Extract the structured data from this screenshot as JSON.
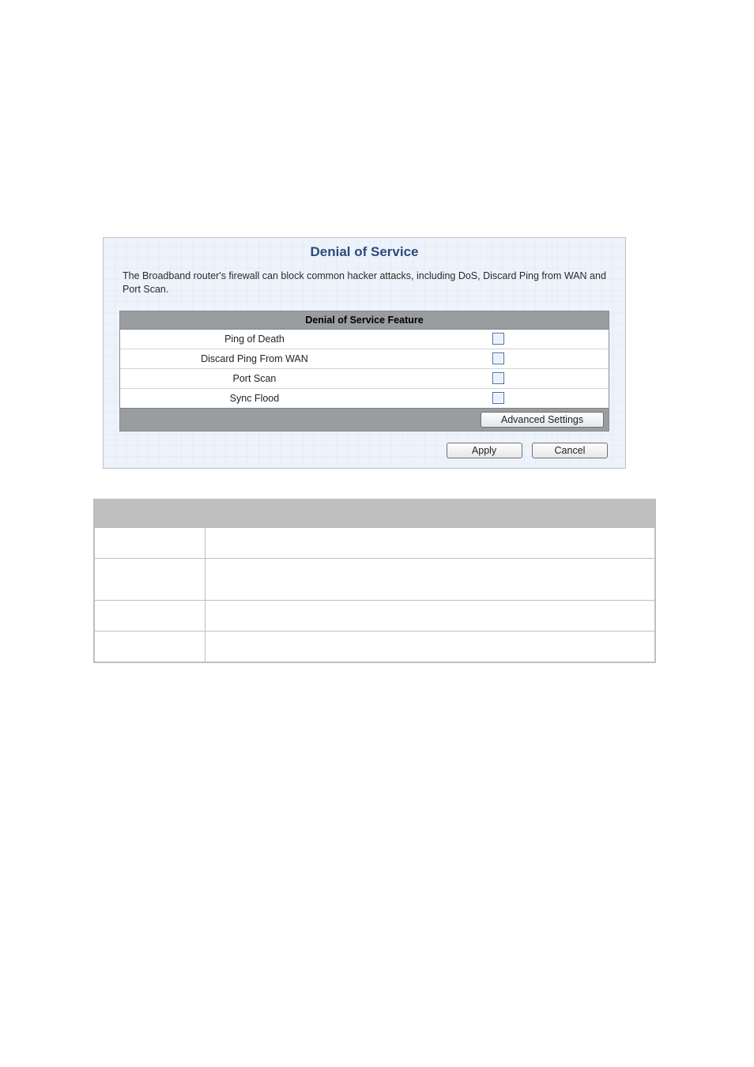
{
  "ui": {
    "title": "Denial of Service",
    "description": "The Broadband router's firewall can block common hacker attacks, including DoS, Discard Ping from WAN and Port Scan.",
    "feature_header": "Denial of Service Feature",
    "rows": [
      {
        "label": "Ping of Death"
      },
      {
        "label": "Discard Ping From WAN"
      },
      {
        "label": "Port Scan"
      },
      {
        "label": "Sync Flood"
      }
    ],
    "advanced_button": "Advanced Settings",
    "apply_button": "Apply",
    "cancel_button": "Cancel"
  },
  "desc_table": {
    "headers": {
      "param": "",
      "desc": ""
    },
    "rows": [
      {
        "param": "",
        "desc": "",
        "tall": false
      },
      {
        "param": "",
        "desc": "",
        "tall": true
      },
      {
        "param": "",
        "desc": "",
        "tall": false
      },
      {
        "param": "",
        "desc": "",
        "tall": false
      }
    ]
  }
}
